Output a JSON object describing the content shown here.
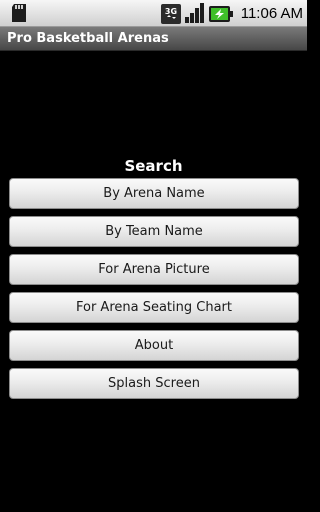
{
  "status_bar": {
    "time": "11:06 AM",
    "network_label": "3G",
    "icons": [
      "sd-card-icon",
      "3g-data-icon",
      "signal-strength-icon",
      "battery-charging-icon"
    ]
  },
  "app": {
    "title": "Pro Basketball Arenas"
  },
  "search": {
    "heading": "Search",
    "buttons": [
      {
        "label": "By Arena Name"
      },
      {
        "label": "By Team Name"
      },
      {
        "label": "For Arena Picture"
      },
      {
        "label": "For Arena Seating Chart"
      },
      {
        "label": "About"
      },
      {
        "label": "Splash Screen"
      }
    ]
  },
  "colors": {
    "background": "#000000",
    "title_bar": "#5a5a5a",
    "button_face": "#ececec",
    "battery_green": "#3fbf2a"
  }
}
